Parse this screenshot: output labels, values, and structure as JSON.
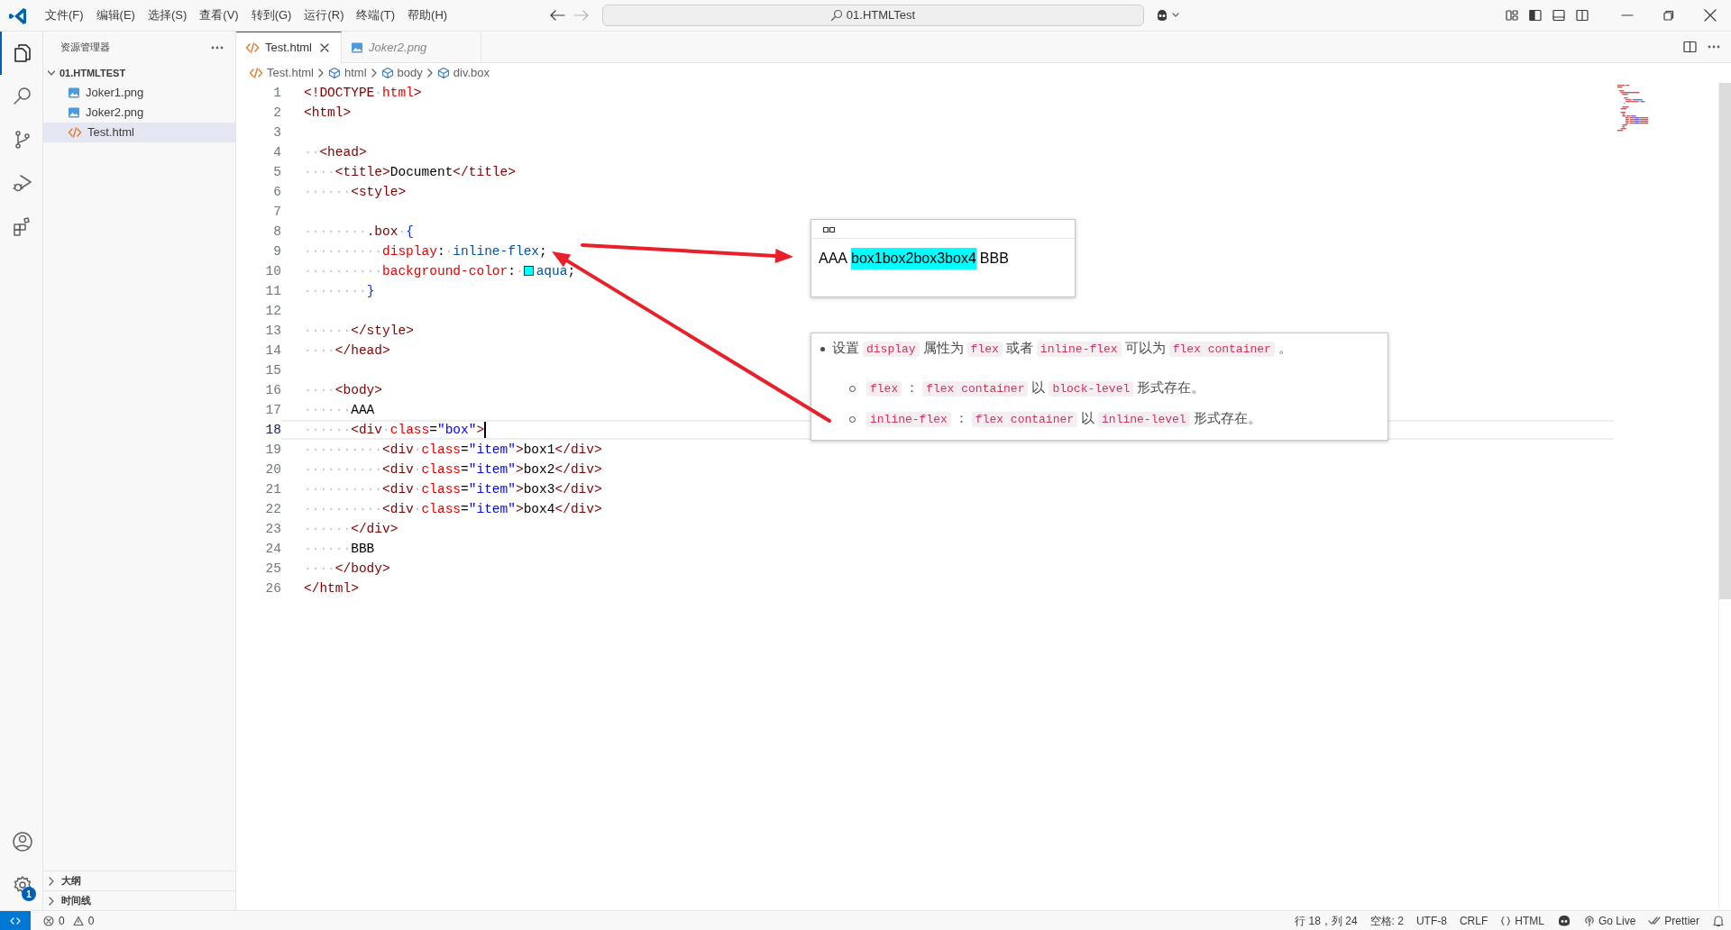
{
  "title_bar": {
    "menus": [
      "文件(F)",
      "编辑(E)",
      "选择(S)",
      "查看(V)",
      "转到(G)",
      "运行(R)",
      "终端(T)",
      "帮助(H)"
    ],
    "search": "01.HTMLTest"
  },
  "activity_bar": {
    "items": [
      {
        "kind": "explorer",
        "selected": true
      },
      {
        "kind": "search",
        "selected": false
      },
      {
        "kind": "source-control",
        "selected": false
      },
      {
        "kind": "run-debug",
        "selected": false
      },
      {
        "kind": "extensions",
        "selected": false
      }
    ],
    "settings_badge": "1"
  },
  "sidebar": {
    "title": "资源管理器",
    "folder": {
      "name": "01.HTMLTEST",
      "expanded": true,
      "children": [
        {
          "name": "Joker1.png",
          "kind": "image",
          "selected": false
        },
        {
          "name": "Joker2.png",
          "kind": "image",
          "selected": false
        },
        {
          "name": "Test.html",
          "kind": "html",
          "selected": true
        }
      ]
    },
    "sections": [
      {
        "name": "大纲",
        "expanded": false
      },
      {
        "name": "时间线",
        "expanded": false
      }
    ]
  },
  "tabs": [
    {
      "label": "Test.html",
      "kind": "html",
      "selected": true,
      "preview": false
    },
    {
      "label": "Joker2.png",
      "kind": "image",
      "selected": false,
      "preview": true
    }
  ],
  "breadcrumbs": [
    {
      "label": "Test.html",
      "kind": "html"
    },
    {
      "label": "html",
      "kind": "element"
    },
    {
      "label": "body",
      "kind": "element"
    },
    {
      "label": "div.box",
      "kind": "element"
    }
  ],
  "editor": {
    "lines": [
      {
        "number": "1",
        "current": false,
        "tokens": [
          {
            "kind": "tag",
            "text": "<!DOCTYPE"
          },
          {
            "kind": "ws",
            "text": "·"
          },
          {
            "kind": "attr",
            "text": "html"
          },
          {
            "kind": "tag",
            "text": ">"
          }
        ]
      },
      {
        "number": "2",
        "current": false,
        "tokens": [
          {
            "kind": "tag",
            "text": "<html>"
          }
        ]
      },
      {
        "number": "3",
        "current": false
      },
      {
        "number": "4",
        "current": false,
        "tokens": [
          {
            "kind": "ws",
            "text": "··"
          },
          {
            "kind": "tag",
            "text": "<head>"
          }
        ]
      },
      {
        "number": "5",
        "current": false,
        "tokens": [
          {
            "kind": "ws",
            "text": "····"
          },
          {
            "kind": "tag",
            "text": "<title>"
          },
          {
            "kind": "text",
            "text": "Document"
          },
          {
            "kind": "tag",
            "text": "</title>"
          }
        ]
      },
      {
        "number": "6",
        "current": false,
        "tokens": [
          {
            "kind": "ws",
            "text": "······"
          },
          {
            "kind": "tag",
            "text": "<style>"
          }
        ]
      },
      {
        "number": "7",
        "current": false
      },
      {
        "number": "8",
        "current": false,
        "tokens": [
          {
            "kind": "ws",
            "text": "········"
          },
          {
            "kind": "sel",
            "text": ".box"
          },
          {
            "kind": "ws",
            "text": "·"
          },
          {
            "kind": "brace",
            "text": "{"
          }
        ]
      },
      {
        "number": "9",
        "current": false,
        "tokens": [
          {
            "kind": "ws",
            "text": "··········"
          },
          {
            "kind": "prop",
            "text": "display"
          },
          {
            "kind": "punct",
            "text": ":"
          },
          {
            "kind": "ws",
            "text": "·"
          },
          {
            "kind": "val",
            "text": "inline-flex"
          },
          {
            "kind": "punct",
            "text": ";"
          }
        ]
      },
      {
        "number": "10",
        "current": false,
        "tokens": [
          {
            "kind": "ws",
            "text": "··········"
          },
          {
            "kind": "prop",
            "text": "background-color"
          },
          {
            "kind": "punct",
            "text": ":"
          },
          {
            "kind": "ws",
            "text": "·"
          },
          {
            "kind": "swatch",
            "color": "#00ffff"
          },
          {
            "kind": "val",
            "text": "aqua"
          },
          {
            "kind": "punct",
            "text": ";"
          }
        ]
      },
      {
        "number": "11",
        "current": false,
        "tokens": [
          {
            "kind": "ws",
            "text": "········"
          },
          {
            "kind": "brace",
            "text": "}"
          }
        ]
      },
      {
        "number": "12",
        "current": false
      },
      {
        "number": "13",
        "current": false,
        "tokens": [
          {
            "kind": "ws",
            "text": "······"
          },
          {
            "kind": "tag",
            "text": "</style>"
          }
        ]
      },
      {
        "number": "14",
        "current": false,
        "tokens": [
          {
            "kind": "ws",
            "text": "····"
          },
          {
            "kind": "tag",
            "text": "</head>"
          }
        ]
      },
      {
        "number": "15",
        "current": false
      },
      {
        "number": "16",
        "current": false,
        "tokens": [
          {
            "kind": "ws",
            "text": "····"
          },
          {
            "kind": "tag",
            "text": "<body>"
          }
        ]
      },
      {
        "number": "17",
        "current": false,
        "tokens": [
          {
            "kind": "ws",
            "text": "······"
          },
          {
            "kind": "text",
            "text": "AAA"
          }
        ]
      },
      {
        "number": "18",
        "current": true,
        "tokens": [
          {
            "kind": "ws",
            "text": "······"
          },
          {
            "kind": "tag",
            "text": "<div"
          },
          {
            "kind": "ws",
            "text": "·"
          },
          {
            "kind": "attr",
            "text": "class"
          },
          {
            "kind": "punct",
            "text": "="
          },
          {
            "kind": "str",
            "text": "\"box\""
          },
          {
            "kind": "tag",
            "text": ">"
          }
        ]
      },
      {
        "number": "19",
        "current": false,
        "tokens": [
          {
            "kind": "ws",
            "text": "··········"
          },
          {
            "kind": "tag",
            "text": "<div"
          },
          {
            "kind": "ws",
            "text": "·"
          },
          {
            "kind": "attr",
            "text": "class"
          },
          {
            "kind": "punct",
            "text": "="
          },
          {
            "kind": "str",
            "text": "\"item\""
          },
          {
            "kind": "tag",
            "text": ">"
          },
          {
            "kind": "text",
            "text": "box1"
          },
          {
            "kind": "tag",
            "text": "</div>"
          }
        ]
      },
      {
        "number": "20",
        "current": false,
        "tokens": [
          {
            "kind": "ws",
            "text": "··········"
          },
          {
            "kind": "tag",
            "text": "<div"
          },
          {
            "kind": "ws",
            "text": "·"
          },
          {
            "kind": "attr",
            "text": "class"
          },
          {
            "kind": "punct",
            "text": "="
          },
          {
            "kind": "str",
            "text": "\"item\""
          },
          {
            "kind": "tag",
            "text": ">"
          },
          {
            "kind": "text",
            "text": "box2"
          },
          {
            "kind": "tag",
            "text": "</div>"
          }
        ]
      },
      {
        "number": "21",
        "current": false,
        "tokens": [
          {
            "kind": "ws",
            "text": "··········"
          },
          {
            "kind": "tag",
            "text": "<div"
          },
          {
            "kind": "ws",
            "text": "·"
          },
          {
            "kind": "attr",
            "text": "class"
          },
          {
            "kind": "punct",
            "text": "="
          },
          {
            "kind": "str",
            "text": "\"item\""
          },
          {
            "kind": "tag",
            "text": ">"
          },
          {
            "kind": "text",
            "text": "box3"
          },
          {
            "kind": "tag",
            "text": "</div>"
          }
        ]
      },
      {
        "number": "22",
        "current": false,
        "tokens": [
          {
            "kind": "ws",
            "text": "··········"
          },
          {
            "kind": "tag",
            "text": "<div"
          },
          {
            "kind": "ws",
            "text": "·"
          },
          {
            "kind": "attr",
            "text": "class"
          },
          {
            "kind": "punct",
            "text": "="
          },
          {
            "kind": "str",
            "text": "\"item\""
          },
          {
            "kind": "tag",
            "text": ">"
          },
          {
            "kind": "text",
            "text": "box4"
          },
          {
            "kind": "tag",
            "text": "</div>"
          }
        ]
      },
      {
        "number": "23",
        "current": false,
        "tokens": [
          {
            "kind": "ws",
            "text": "······"
          },
          {
            "kind": "tag",
            "text": "</div>"
          }
        ]
      },
      {
        "number": "24",
        "current": false,
        "tokens": [
          {
            "kind": "ws",
            "text": "······"
          },
          {
            "kind": "text",
            "text": "BBB"
          }
        ]
      },
      {
        "number": "25",
        "current": false,
        "tokens": [
          {
            "kind": "ws",
            "text": "····"
          },
          {
            "kind": "tag",
            "text": "</body>"
          }
        ]
      },
      {
        "number": "26",
        "current": false,
        "tokens": [
          {
            "kind": "tag",
            "text": "</html>"
          }
        ]
      }
    ]
  },
  "preview": {
    "segments": [
      {
        "text": "AAA",
        "highlighted": false
      },
      {
        "text": "box1box2box3box4",
        "highlighted": true
      },
      {
        "text": "BBB",
        "highlighted": false
      }
    ]
  },
  "hover_note": {
    "items": [
      {
        "parts": [
          {
            "kind": "text",
            "text": "设置"
          },
          {
            "kind": "code",
            "text": "display"
          },
          {
            "kind": "text",
            "text": "属性为"
          },
          {
            "kind": "code",
            "text": "flex"
          },
          {
            "kind": "text",
            "text": "或者"
          },
          {
            "kind": "code",
            "text": "inline-flex"
          },
          {
            "kind": "text",
            "text": "可以为"
          },
          {
            "kind": "code",
            "text": "flex container"
          },
          {
            "kind": "text",
            "text": "。"
          }
        ],
        "children": [
          {
            "parts": [
              {
                "kind": "code",
                "text": "flex"
              },
              {
                "kind": "text",
                "text": "："
              },
              {
                "kind": "code",
                "text": "flex container"
              },
              {
                "kind": "text",
                "text": "以"
              },
              {
                "kind": "code",
                "text": "block-level"
              },
              {
                "kind": "text",
                "text": "形式存在。"
              }
            ]
          },
          {
            "parts": [
              {
                "kind": "code",
                "text": "inline-flex"
              },
              {
                "kind": "text",
                "text": "："
              },
              {
                "kind": "code",
                "text": "flex container"
              },
              {
                "kind": "text",
                "text": "以"
              },
              {
                "kind": "code",
                "text": "inline-level"
              },
              {
                "kind": "text",
                "text": "形式存在。"
              }
            ]
          }
        ]
      }
    ]
  },
  "status_bar": {
    "errors": "0",
    "warnings": "0",
    "items": [
      {
        "kind": "text",
        "text": "行 18，列 24"
      },
      {
        "kind": "text",
        "text": "空格: 2"
      },
      {
        "kind": "text",
        "text": "UTF-8"
      },
      {
        "kind": "text",
        "text": "CRLF"
      },
      {
        "kind": "language",
        "text": "HTML"
      },
      {
        "kind": "copilot"
      },
      {
        "kind": "live",
        "text": "Go Live"
      },
      {
        "kind": "prettier",
        "text": "Prettier"
      },
      {
        "kind": "bell"
      }
    ]
  }
}
